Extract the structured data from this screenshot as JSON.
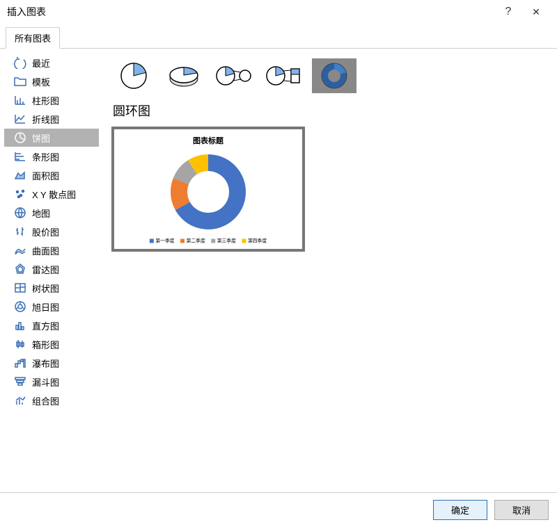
{
  "dialog": {
    "title": "插入图表",
    "help_symbol": "?",
    "close_symbol": "✕"
  },
  "tabs": [
    {
      "label": "所有图表",
      "active": true
    }
  ],
  "sidebar": {
    "items": [
      {
        "label": "最近",
        "icon": "recent"
      },
      {
        "label": "模板",
        "icon": "template"
      },
      {
        "label": "柱形图",
        "icon": "column"
      },
      {
        "label": "折线图",
        "icon": "line"
      },
      {
        "label": "饼图",
        "icon": "pie",
        "selected": true
      },
      {
        "label": "条形图",
        "icon": "bar"
      },
      {
        "label": "面积图",
        "icon": "area"
      },
      {
        "label": "X Y 散点图",
        "icon": "scatter"
      },
      {
        "label": "地图",
        "icon": "map"
      },
      {
        "label": "股价图",
        "icon": "stock"
      },
      {
        "label": "曲面图",
        "icon": "surface"
      },
      {
        "label": "雷达图",
        "icon": "radar"
      },
      {
        "label": "树状图",
        "icon": "treemap"
      },
      {
        "label": "旭日图",
        "icon": "sunburst"
      },
      {
        "label": "直方图",
        "icon": "histogram"
      },
      {
        "label": "箱形图",
        "icon": "box"
      },
      {
        "label": "瀑布图",
        "icon": "waterfall"
      },
      {
        "label": "漏斗图",
        "icon": "funnel"
      },
      {
        "label": "组合图",
        "icon": "combo"
      }
    ]
  },
  "subtypes": {
    "selected_index": 4,
    "items": [
      "pie",
      "pie-3d",
      "pie-of-pie",
      "bar-of-pie",
      "doughnut"
    ]
  },
  "preview": {
    "title": "圆环图",
    "chart_title": "图表标题",
    "legend": [
      "第一季度",
      "第二季度",
      "第三季度",
      "第四季度"
    ]
  },
  "chart_data": {
    "type": "pie",
    "subtype": "doughnut",
    "title": "图表标题",
    "categories": [
      "第一季度",
      "第二季度",
      "第三季度",
      "第四季度"
    ],
    "values": [
      58,
      23,
      10,
      9
    ],
    "colors": [
      "#4472c4",
      "#ed7d31",
      "#a5a5a5",
      "#ffc000"
    ]
  },
  "buttons": {
    "ok": "确定",
    "cancel": "取消"
  },
  "colors": {
    "accent": "#4472c4"
  }
}
